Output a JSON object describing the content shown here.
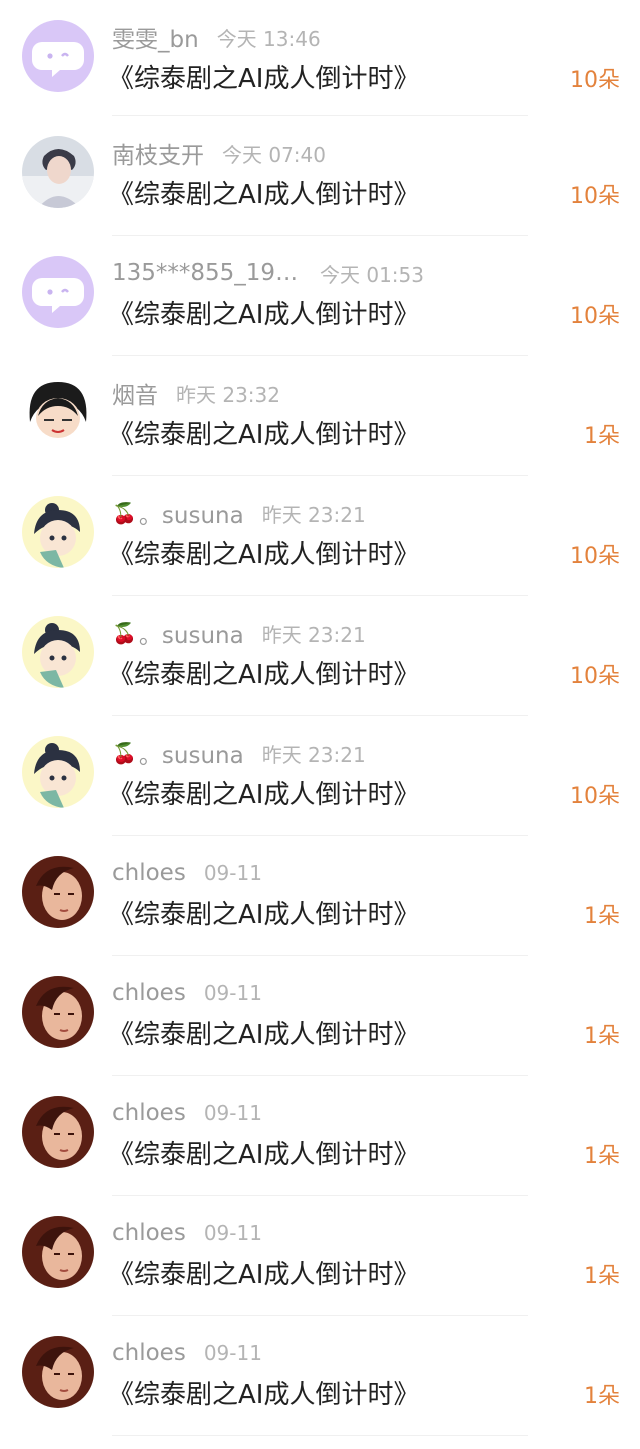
{
  "colors": {
    "username": "#9a9a9a",
    "time": "#b4b4b4",
    "title": "#222222",
    "gift_count": "#e3823c",
    "divider": "#f0f0f0"
  },
  "list": [
    {
      "avatar": "purple-chat-avatar-icon",
      "username": "雯雯_bn",
      "time": "今天 13:46",
      "title": "《综泰剧之AI成人倒计时》",
      "gift": "10朵"
    },
    {
      "avatar": "photo-avatar-icon",
      "username": "南枝支开",
      "time": "今天 07:40",
      "title": "《综泰剧之AI成人倒计时》",
      "gift": "10朵"
    },
    {
      "avatar": "purple-chat-avatar-icon",
      "username": "135***855_198...",
      "time": "今天 01:53",
      "title": "《综泰剧之AI成人倒计时》",
      "gift": "10朵"
    },
    {
      "avatar": "cartoon-girl-avatar-icon",
      "username": "烟音",
      "time": "昨天 23:32",
      "title": "《综泰剧之AI成人倒计时》",
      "gift": "1朵"
    },
    {
      "avatar": "cartoon-boy-avatar-icon",
      "username_emoji": "🍒",
      "username": "。susuna",
      "time": "昨天 23:21",
      "title": "《综泰剧之AI成人倒计时》",
      "gift": "10朵"
    },
    {
      "avatar": "cartoon-boy-avatar-icon",
      "username_emoji": "🍒",
      "username": "。susuna",
      "time": "昨天 23:21",
      "title": "《综泰剧之AI成人倒计时》",
      "gift": "10朵"
    },
    {
      "avatar": "cartoon-boy-avatar-icon",
      "username_emoji": "🍒",
      "username": "。susuna",
      "time": "昨天 23:21",
      "title": "《综泰剧之AI成人倒计时》",
      "gift": "10朵"
    },
    {
      "avatar": "selfie-avatar-icon",
      "username": "chloes",
      "time": "09-11",
      "title": "《综泰剧之AI成人倒计时》",
      "gift": "1朵"
    },
    {
      "avatar": "selfie-avatar-icon",
      "username": "chloes",
      "time": "09-11",
      "title": "《综泰剧之AI成人倒计时》",
      "gift": "1朵"
    },
    {
      "avatar": "selfie-avatar-icon",
      "username": "chloes",
      "time": "09-11",
      "title": "《综泰剧之AI成人倒计时》",
      "gift": "1朵"
    },
    {
      "avatar": "selfie-avatar-icon",
      "username": "chloes",
      "time": "09-11",
      "title": "《综泰剧之AI成人倒计时》",
      "gift": "1朵"
    },
    {
      "avatar": "selfie-avatar-icon",
      "username": "chloes",
      "time": "09-11",
      "title": "《综泰剧之AI成人倒计时》",
      "gift": "1朵"
    }
  ]
}
